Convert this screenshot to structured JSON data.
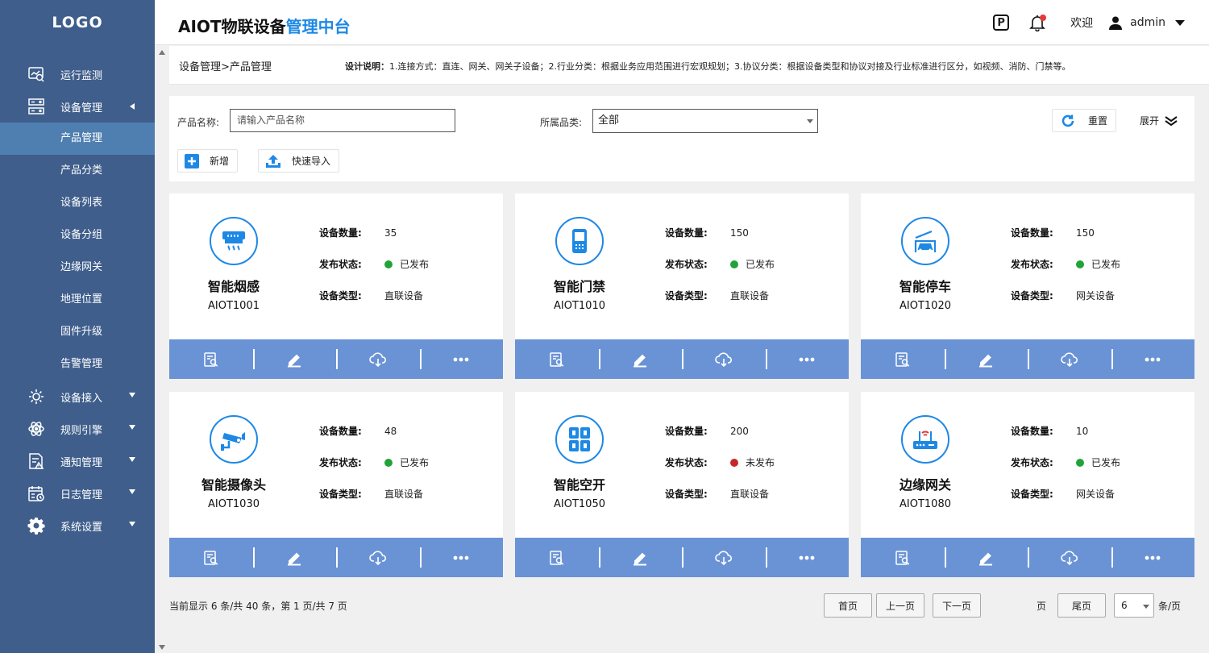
{
  "sidebar": {
    "logo": "LOGO",
    "items": [
      {
        "label": "运行监测",
        "icon": "monitor-icon"
      },
      {
        "label": "设备管理",
        "icon": "server-icon"
      },
      {
        "label": "设备接入",
        "icon": "access-icon"
      },
      {
        "label": "规则引擎",
        "icon": "rule-engine-icon"
      },
      {
        "label": "通知管理",
        "icon": "notice-icon"
      },
      {
        "label": "日志管理",
        "icon": "log-icon"
      },
      {
        "label": "系统设置",
        "icon": "gear-icon"
      }
    ],
    "subitems": [
      "产品管理",
      "产品分类",
      "设备列表",
      "设备分组",
      "边缘网关",
      "地理位置",
      "固件升级",
      "告警管理"
    ]
  },
  "header": {
    "title_prefix": "AIOT物联设备",
    "title_highlight": "管理中台",
    "welcome": "欢迎",
    "username": "admin",
    "accent": "#1e88e5"
  },
  "breadcrumb": "设备管理>产品管理",
  "design_note": {
    "label": "设计说明：",
    "text": "1.连接方式：直连、网关、网关子设备；2.行业分类：根据业务应用范围进行宏观规划；3.协议分类：根据设备类型和协议对接及行业标准进行区分，如视频、消防、门禁等。"
  },
  "filter": {
    "name_label": "产品名称:",
    "name_placeholder": "请输入产品名称",
    "category_label": "所属品类:",
    "category_value": "全部",
    "reset": "重置",
    "expand": "展开",
    "add": "新增",
    "import": "快速导入"
  },
  "field_labels": {
    "count": "设备数量:",
    "status": "发布状态:",
    "type": "设备类型:"
  },
  "products": [
    {
      "name": "智能烟感",
      "code": "AIOT1001",
      "count": "35",
      "status": "已发布",
      "status_color": "#22a33a",
      "type": "直联设备",
      "icon": "smoke-detector-icon"
    },
    {
      "name": "智能门禁",
      "code": "AIOT1010",
      "count": "150",
      "status": "已发布",
      "status_color": "#22a33a",
      "type": "直联设备",
      "icon": "door-access-icon"
    },
    {
      "name": "智能停车",
      "code": "AIOT1020",
      "count": "150",
      "status": "已发布",
      "status_color": "#22a33a",
      "type": "网关设备",
      "icon": "parking-icon"
    },
    {
      "name": "智能摄像头",
      "code": "AIOT1030",
      "count": "48",
      "status": "已发布",
      "status_color": "#22a33a",
      "type": "直联设备",
      "icon": "camera-icon"
    },
    {
      "name": "智能空开",
      "code": "AIOT1050",
      "count": "200",
      "status": "未发布",
      "status_color": "#c62828",
      "type": "直联设备",
      "icon": "circuit-breaker-icon"
    },
    {
      "name": "边缘网关",
      "code": "AIOT1080",
      "count": "10",
      "status": "已发布",
      "status_color": "#22a33a",
      "type": "网关设备",
      "icon": "router-icon"
    }
  ],
  "pagination": {
    "info": "当前显示 6 条/共 40 条，第 1 页/共 7 页",
    "first": "首页",
    "prev": "上一页",
    "next": "下一页",
    "page_suffix": "页",
    "last": "尾页",
    "page_size": "6",
    "per_page_suffix": "条/页"
  }
}
